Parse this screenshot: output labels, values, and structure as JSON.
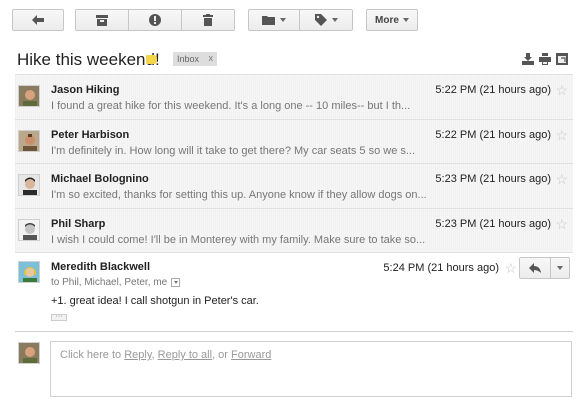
{
  "toolbar": {
    "more_label": "More"
  },
  "subject": {
    "title": "Hike this weekend!",
    "label_color": "#f3d54a",
    "chip_label": "Inbox",
    "chip_close": "x"
  },
  "messages": [
    {
      "sender": "Jason Hiking",
      "snippet": "I found a great hike for this weekend. It's a long one -- 10 miles-- but I th...",
      "time": "5:22 PM (21 hours ago)",
      "star": "☆"
    },
    {
      "sender": "Peter Harbison",
      "snippet": "I'm definitely in. How long will it take to get there? My car seats 5 so we s...",
      "time": "5:22 PM (21 hours ago)",
      "star": "☆"
    },
    {
      "sender": "Michael Bolognino",
      "snippet": "I'm so excited, thanks for setting this up. Anyone know if they allow dogs on...",
      "time": "5:23 PM (21 hours ago)",
      "star": "☆"
    },
    {
      "sender": "Phil Sharp",
      "snippet": "I wish I could come! I'll be in Monterey with my family. Make sure to take so...",
      "time": "5:23 PM (21 hours ago)",
      "star": "☆"
    }
  ],
  "expanded": {
    "sender": "Meredith Blackwell",
    "to": "to Phil, Michael, Peter, me",
    "time": "5:24 PM (21 hours ago)",
    "star": "☆",
    "body": "+1. great idea! I call shotgun in Peter's car.",
    "ellipsis": "···"
  },
  "reply": {
    "prefix": "Click here to ",
    "reply": "Reply",
    "sep1": ", ",
    "reply_all": "Reply to all",
    "sep2": ", or ",
    "forward": "Forward"
  }
}
